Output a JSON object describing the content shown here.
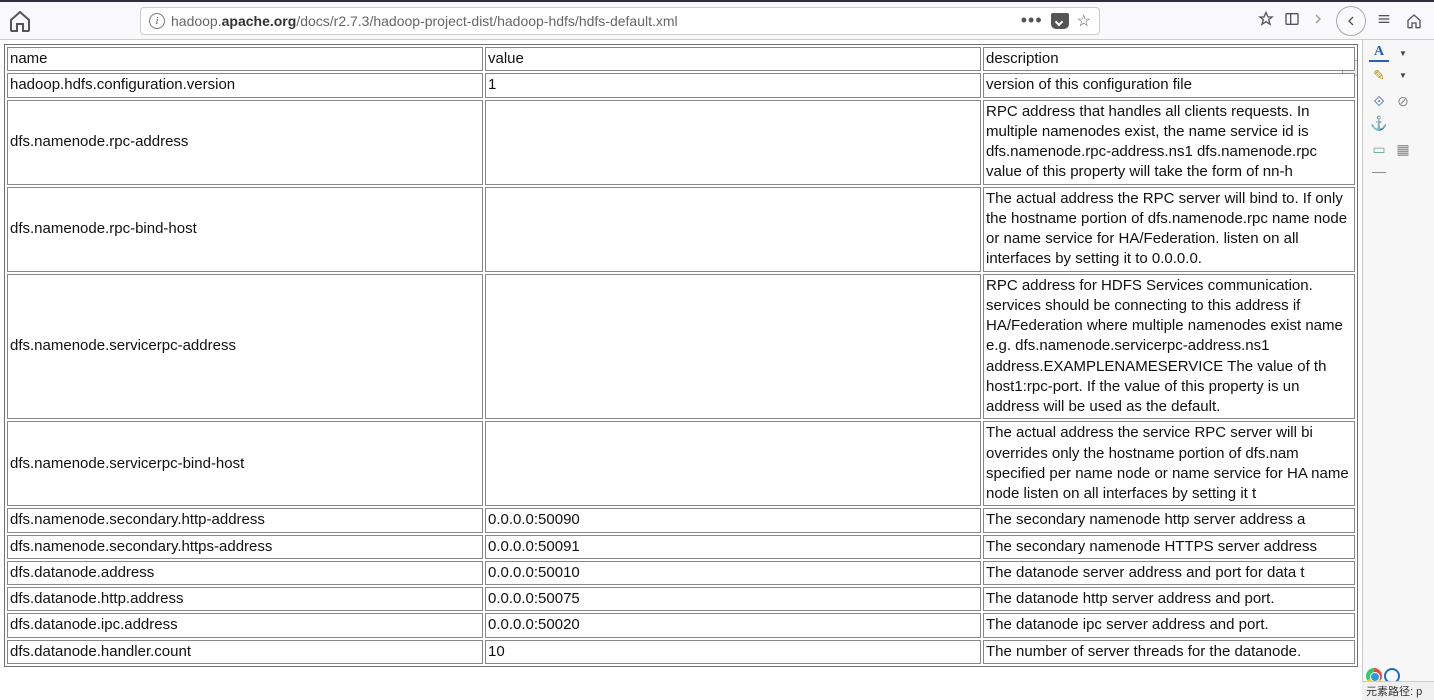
{
  "url_prefix": "hadoop.",
  "url_bold": "apache.org",
  "url_suffix": "/docs/r2.7.3/hadoop-project-dist/hadoop-hdfs/hdfs-default.xml",
  "headers": {
    "name": "name",
    "value": "value",
    "description": "description"
  },
  "rows": [
    {
      "name": "hadoop.hdfs.configuration.version",
      "value": "1",
      "description": "version of this configuration file"
    },
    {
      "name": "dfs.namenode.rpc-address",
      "value": "",
      "description": "RPC address that handles all clients requests. In multiple namenodes exist, the name service id is dfs.namenode.rpc-address.ns1 dfs.namenode.rpc value of this property will take the form of nn-h"
    },
    {
      "name": "dfs.namenode.rpc-bind-host",
      "value": "",
      "description": "The actual address the RPC server will bind to. If only the hostname portion of dfs.namenode.rpc name node or name service for HA/Federation. listen on all interfaces by setting it to 0.0.0.0."
    },
    {
      "name": "dfs.namenode.servicerpc-address",
      "value": "",
      "description": "RPC address for HDFS Services communication. services should be connecting to this address if HA/Federation where multiple namenodes exist name e.g. dfs.namenode.servicerpc-address.ns1 address.EXAMPLENAMESERVICE The value of th host1:rpc-port. If the value of this property is un address will be used as the default."
    },
    {
      "name": "dfs.namenode.servicerpc-bind-host",
      "value": "",
      "description": "The actual address the service RPC server will bi overrides only the hostname portion of dfs.nam specified per name node or name service for HA name node listen on all interfaces by setting it t"
    },
    {
      "name": "dfs.namenode.secondary.http-address",
      "value": "0.0.0.0:50090",
      "description": "The secondary namenode http server address a"
    },
    {
      "name": "dfs.namenode.secondary.https-address",
      "value": "0.0.0.0:50091",
      "description": "The secondary namenode HTTPS server address"
    },
    {
      "name": "dfs.datanode.address",
      "value": "0.0.0.0:50010",
      "description": "The datanode server address and port for data t"
    },
    {
      "name": "dfs.datanode.http.address",
      "value": "0.0.0.0:50075",
      "description": "The datanode http server address and port."
    },
    {
      "name": "dfs.datanode.ipc.address",
      "value": "0.0.0.0:50020",
      "description": "The datanode ipc server address and port."
    },
    {
      "name": "dfs.datanode.handler.count",
      "value": "10",
      "description": "The number of server threads for the datanode."
    }
  ],
  "status_text": "元素路径: p"
}
